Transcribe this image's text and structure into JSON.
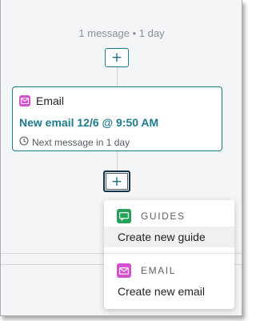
{
  "flow": {
    "step_summary": "1 message • 1 day",
    "add_step_symbol": "+"
  },
  "email_card": {
    "type_label": "Email",
    "title": "New email 12/6 @ 9:50 AM",
    "next_message": "Next message in 1 day"
  },
  "add_menu": {
    "sections": [
      {
        "heading": "GUIDES",
        "icon": "guides-icon",
        "icon_color": "#26a15a",
        "item": "Create new guide"
      },
      {
        "heading": "EMAIL",
        "icon": "email-icon",
        "icon_color": "#d94fd1",
        "item": "Create new email"
      }
    ]
  },
  "colors": {
    "accent": "#1f7a8c",
    "email": "#d94fd1",
    "guides": "#26a15a"
  }
}
